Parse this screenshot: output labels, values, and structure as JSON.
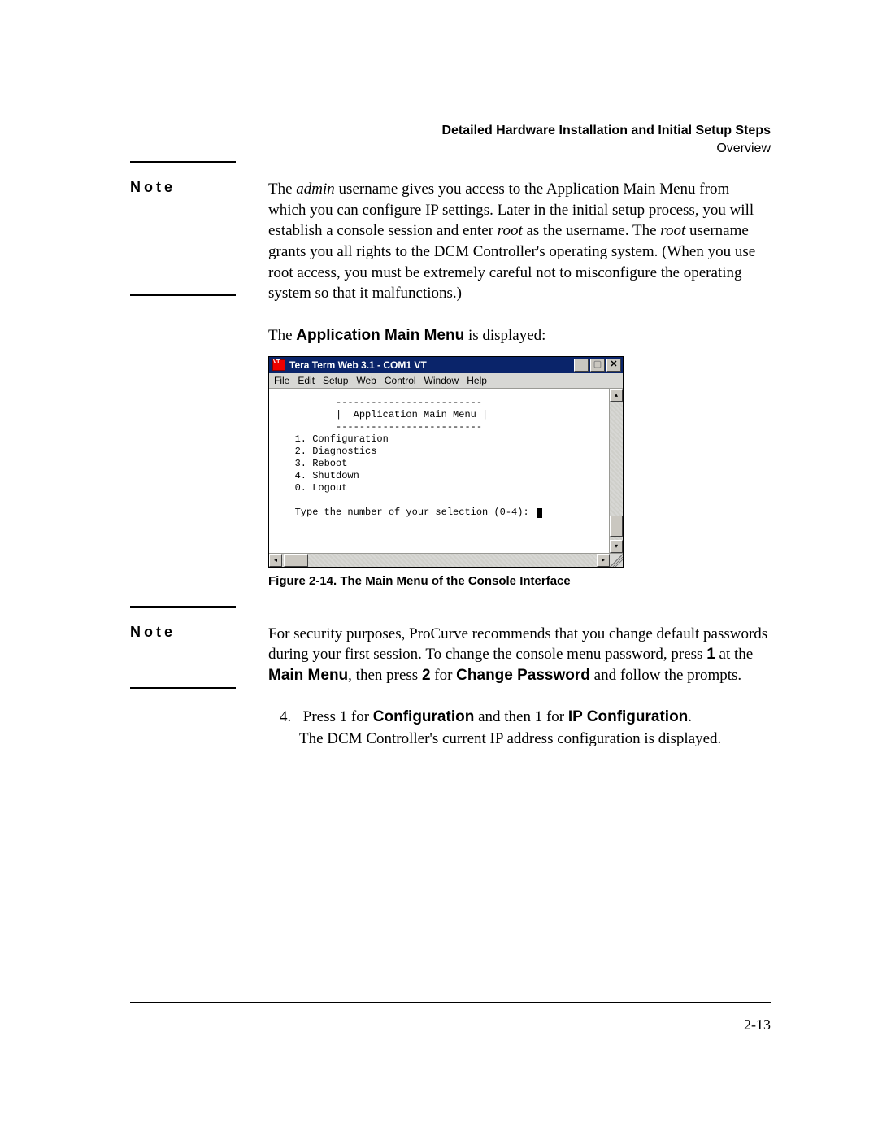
{
  "header": {
    "title": "Detailed Hardware Installation and Initial Setup Steps",
    "subtitle": "Overview"
  },
  "note1": {
    "label": "Note",
    "text_before_admin": "The ",
    "admin": "admin",
    "text_after_admin": " username gives you access to the Application Main Menu from which you can configure IP settings. Later in the initial setup process, you will establish a console session and enter ",
    "root1": "root",
    "mid1": " as the username. The ",
    "root2": "root",
    "mid2": " username grants you all rights to the DCM Controller's operating system. (When you use root access, you must be extremely careful not to misconfigure the operating system so that it malfunctions.)"
  },
  "lead_in": {
    "pre": "The ",
    "strong": "Application Main Menu",
    "post": " is displayed:"
  },
  "figure": {
    "caption": "Figure 2-14.  The Main Menu of the Console Interface"
  },
  "terminal": {
    "title": "Tera Term Web 3.1 - COM1 VT",
    "menus": [
      "File",
      "Edit",
      "Setup",
      "Web",
      "Control",
      "Window",
      "Help"
    ],
    "lines": [
      "          -------------------------",
      "          |  Application Main Menu |",
      "          -------------------------",
      "   1. Configuration",
      "   2. Diagnostics",
      "   3. Reboot",
      "   4. Shutdown",
      "   0. Logout",
      "",
      "   Type the number of your selection (0-4): "
    ]
  },
  "note2": {
    "label": "Note",
    "t1": "For security purposes, ProCurve recommends that you change default pass­words during your first session. To change the console menu password, press ",
    "b1": "1",
    "t2": " at the ",
    "b2": "Main Menu",
    "t3": ", then press ",
    "b3": "2",
    "t4": " for ",
    "b4": "Change Password",
    "t5": " and follow the prompts."
  },
  "step4": {
    "num": "4.",
    "l1a": "Press 1 for ",
    "l1b": "Configuration",
    "l1c": " and then 1 for ",
    "l1d": "IP Configuration",
    "l1e": ".",
    "l2": "The DCM Controller's current IP address configuration is displayed."
  },
  "page_number": "2-13"
}
